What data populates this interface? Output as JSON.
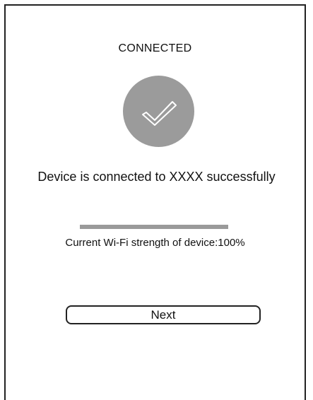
{
  "screen": {
    "title": "CONNECTED",
    "status_icon": "checkmark-icon",
    "message": "Device is connected to XXXX successfully",
    "wifi_strength": {
      "label": "Current Wi-Fi strength of device:100%",
      "percent": 100
    },
    "next_button_label": "Next"
  },
  "colors": {
    "circle": "#9b9b9b",
    "bar": "#9a9a9a",
    "border": "#222222",
    "background": "#ffffff"
  }
}
